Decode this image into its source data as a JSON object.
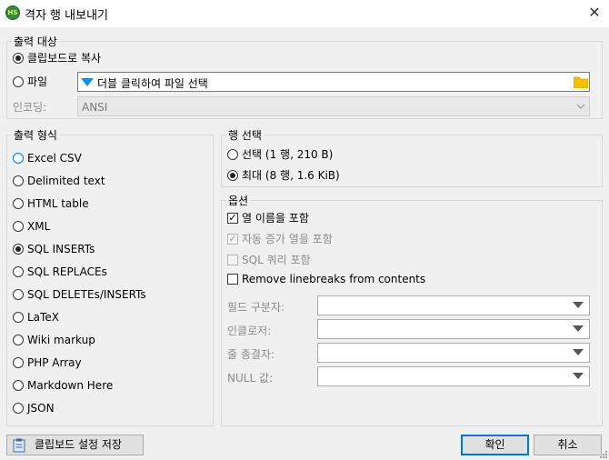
{
  "window": {
    "app_icon_text": "HS",
    "title": "격자 행 내보내기"
  },
  "output_target": {
    "legend": "출력 대상",
    "clipboard_label": "클립보드로 복사",
    "clipboard_selected": true,
    "file_label": "파일",
    "file_value": "더블 클릭하여 파일 선택",
    "encoding_label": "인코딩:",
    "encoding_value": "ANSI"
  },
  "output_format": {
    "legend": "출력 형식",
    "options": [
      "Excel CSV",
      "Delimited text",
      "HTML table",
      "XML",
      "SQL INSERTs",
      "SQL REPLACEs",
      "SQL DELETEs/INSERTs",
      "LaTeX",
      "Wiki markup",
      "PHP Array",
      "Markdown Here",
      "JSON"
    ],
    "selected": "SQL INSERTs"
  },
  "row_selection": {
    "legend": "행 선택",
    "options": [
      "선택 (1 행, 210 B)",
      "최대 (8 행, 1.6 KiB)"
    ],
    "selected": "최대 (8 행, 1.6 KiB)"
  },
  "options": {
    "legend": "옵션",
    "checkboxes": [
      {
        "label": "열 이름을 포함",
        "checked": true,
        "enabled": true
      },
      {
        "label": "자동 증가 열을 포함",
        "checked": true,
        "enabled": false
      },
      {
        "label": "SQL 쿼리 포함",
        "checked": false,
        "enabled": false
      },
      {
        "label": "Remove linebreaks from contents",
        "checked": false,
        "enabled": true
      }
    ],
    "fields": [
      {
        "label": "필드 구분자:",
        "value": ""
      },
      {
        "label": "인클로저:",
        "value": ""
      },
      {
        "label": "줄 종결자:",
        "value": ""
      },
      {
        "label": "NULL 값:",
        "value": ""
      }
    ]
  },
  "buttons": {
    "save_clipboard": "클립보드 설정 저장",
    "ok": "확인",
    "cancel": "취소"
  },
  "colors": {
    "accent": "#0078d7",
    "folder": "#f5c000"
  }
}
